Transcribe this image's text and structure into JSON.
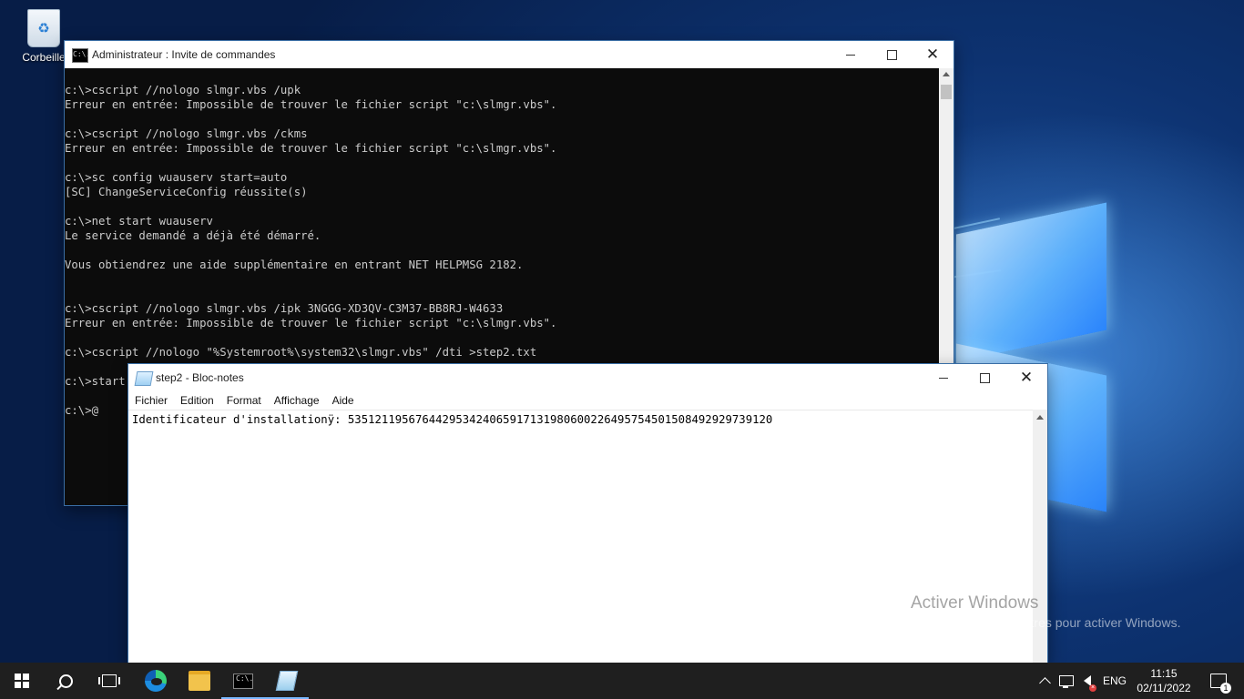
{
  "desktop": {
    "icons": [
      {
        "label": "Corbeille"
      }
    ]
  },
  "cmd_window": {
    "title": "Administrateur : Invite de commandes",
    "icon_text": "C:\\.",
    "lines": [
      "c:\\>cscript //nologo slmgr.vbs /upk",
      "Erreur en entrée: Impossible de trouver le fichier script \"c:\\slmgr.vbs\".",
      "",
      "c:\\>cscript //nologo slmgr.vbs /ckms",
      "Erreur en entrée: Impossible de trouver le fichier script \"c:\\slmgr.vbs\".",
      "",
      "c:\\>sc config wuauserv start=auto",
      "[SC] ChangeServiceConfig réussite(s)",
      "",
      "c:\\>net start wuauserv",
      "Le service demandé a déjà été démarré.",
      "",
      "Vous obtiendrez une aide supplémentaire en entrant NET HELPMSG 2182.",
      "",
      "",
      "c:\\>cscript //nologo slmgr.vbs /ipk 3NGGG-XD3QV-C3M37-BB8RJ-W4633",
      "Erreur en entrée: Impossible de trouver le fichier script \"c:\\slmgr.vbs\".",
      "",
      "c:\\>cscript //nologo \"%Systemroot%\\system32\\slmgr.vbs\" /dti >step2.txt",
      "",
      "c:\\>start",
      "",
      "c:\\>@"
    ]
  },
  "notepad_window": {
    "title": "step2 - Bloc-notes",
    "menu": [
      "Fichier",
      "Edition",
      "Format",
      "Affichage",
      "Aide"
    ],
    "content": "Identificateur d'installationÿ: 535121195676442953424065917131980600226495754501508492929739120"
  },
  "watermark": {
    "title": "Activer Windows",
    "subtitle": "Accédez aux paramètres pour activer Windows."
  },
  "taskbar": {
    "apps": [
      "start-icon",
      "search-icon",
      "task-view-icon",
      "edge-icon",
      "file-explorer-icon",
      "cmd-icon",
      "notepad-icon"
    ],
    "language": "ENG",
    "time": "11:15",
    "date": "02/11/2022",
    "notification_count": "1"
  }
}
